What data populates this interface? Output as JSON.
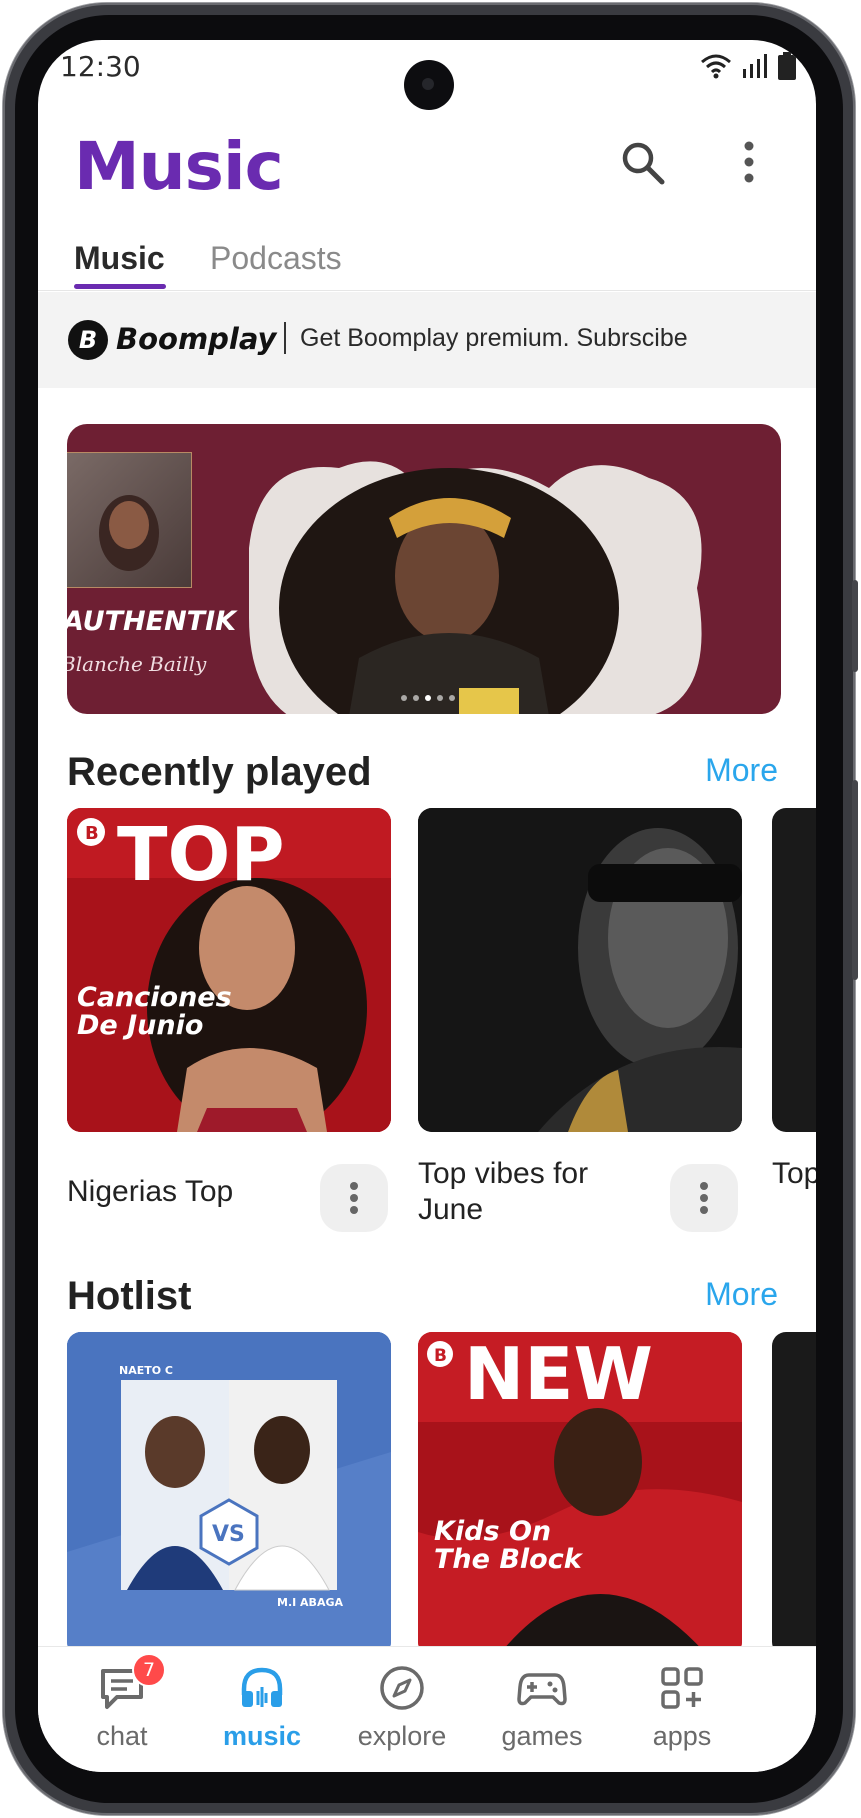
{
  "status": {
    "time": "12:30"
  },
  "header": {
    "title": "Music"
  },
  "tabs": [
    {
      "label": "Music",
      "active": true
    },
    {
      "label": "Podcasts",
      "active": false
    }
  ],
  "promo": {
    "brand": "Boomplay",
    "logo_letter": "B",
    "text": "Get Boomplay premium. Subrscibe"
  },
  "banner": {
    "title": "AUTHENTIK",
    "subtitle": "Blanche Bailly",
    "page_dots": 5,
    "active_dot": 2
  },
  "recently_played": {
    "title": "Recently played",
    "more": "More",
    "items": [
      {
        "label": "Nigerias Top",
        "cover_heading": "TOP",
        "cover_caption": "Canciones De Junio"
      },
      {
        "label": "Top vibes for June"
      },
      {
        "label": "Top vibes for June"
      }
    ]
  },
  "hotlist": {
    "title": "Hotlist",
    "more": "More",
    "items": [
      {
        "artist_left": "NAETO C",
        "versus": "VS",
        "artist_right": "M.I ABAGA"
      },
      {
        "cover_heading": "NEW",
        "cover_caption": "Kids On The Block"
      }
    ]
  },
  "bottom_nav": [
    {
      "label": "chat",
      "badge": "7",
      "icon": "chat-icon"
    },
    {
      "label": "music",
      "active": true,
      "icon": "headphones-icon"
    },
    {
      "label": "explore",
      "icon": "compass-icon"
    },
    {
      "label": "games",
      "icon": "gamepad-icon"
    },
    {
      "label": "apps",
      "icon": "apps-grid-icon"
    }
  ],
  "colors": {
    "accent": "#6a2bb0",
    "link": "#2aa6ec",
    "banner_bg": "#6e1f33",
    "badge": "#ff4a4a"
  }
}
